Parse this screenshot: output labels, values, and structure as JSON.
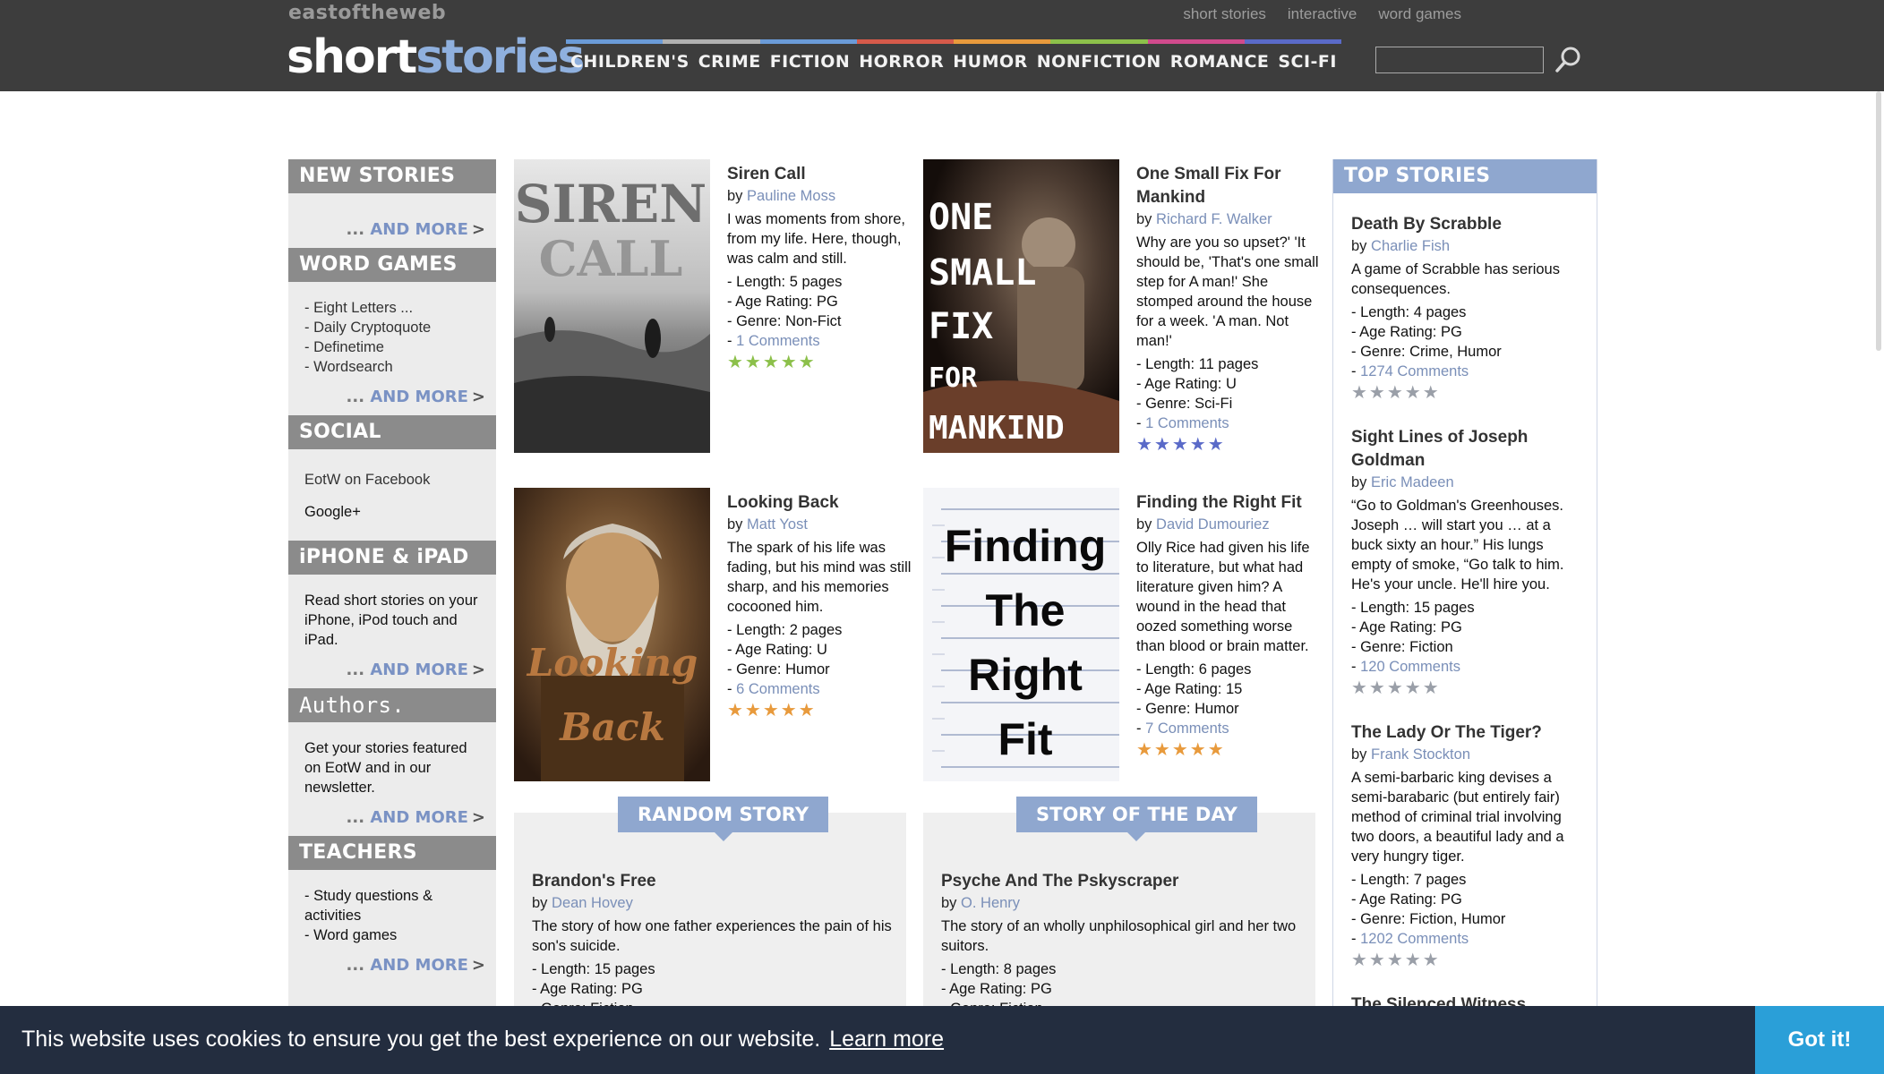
{
  "header": {
    "brand_small": "eastoftheweb",
    "logo_part1": "short",
    "logo_part2": "stories",
    "top_links": [
      "short stories",
      "interactive",
      "word games"
    ],
    "nav": [
      "CHILDREN'S",
      "CRIME",
      "FICTION",
      "HORROR",
      "HUMOR",
      "NONFICTION",
      "ROMANCE",
      "SCI-FI"
    ],
    "nav_colors": [
      "#6a9bd8",
      "#b0b0b0",
      "#6a9bd8",
      "#d65a4a",
      "#e89a3c",
      "#8cc04a",
      "#d04a8c",
      "#5a6ac8"
    ],
    "search_placeholder": ""
  },
  "sidebar": {
    "new_stories": {
      "title": "NEW STORIES"
    },
    "word_games": {
      "title": "WORD GAMES",
      "items": [
        "- Eight Letters ...",
        "- Daily Cryptoquote",
        "- Definetime",
        "- Wordsearch"
      ]
    },
    "social": {
      "title": "SOCIAL",
      "items": [
        "EotW on Facebook",
        "Google+"
      ]
    },
    "iphone": {
      "title": "iPHONE & iPAD",
      "text": "Read short stories on your iPhone, iPod touch and iPad."
    },
    "authors": {
      "title": "Authors.",
      "text": "Get your stories featured on EotW and in our newsletter."
    },
    "teachers": {
      "title": "TEACHERS",
      "items": [
        "- Study questions & activities",
        "- Word games"
      ]
    },
    "more_dots": "...",
    "more_label": "AND MORE",
    "more_chevron": ">"
  },
  "stories": [
    {
      "title": "Siren Call",
      "by": "by",
      "author": "Pauline Moss",
      "blurb": "I was moments from shore, from my life. Here, though, was calm and still.",
      "length": "- Length: 5 pages",
      "rating": "- Age Rating: PG",
      "genre": "- Genre: Non-Fict",
      "comments": "1 Comments",
      "stars": "★★★★★",
      "star_color": "#8cc04a",
      "cover_text": "SIREN CALL"
    },
    {
      "title": "One Small Fix For Mankind",
      "by": "by",
      "author": "Richard F. Walker",
      "blurb": "Why are you so upset?' 'It should be, 'That's one small step for A man!' She stomped around the house for a week. 'A man. Not man!'",
      "length": "- Length: 11 pages",
      "rating": "- Age Rating: U",
      "genre": "- Genre: Sci-Fi",
      "comments": "1 Comments",
      "stars": "★★★★★",
      "star_color": "#5a6ac8",
      "cover_text": [
        "ONE",
        "SMALL",
        "FIX",
        "FOR",
        "MANKIND"
      ]
    },
    {
      "title": "Looking Back",
      "by": "by",
      "author": "Matt Yost",
      "blurb": "The spark of his life was fading, but his mind was still sharp, and his memories cocooned him.",
      "length": "- Length: 2 pages",
      "rating": "- Age Rating: U",
      "genre": "- Genre: Humor",
      "comments": "6 Comments",
      "stars": "★★★★★",
      "star_color": "#e89a3c",
      "cover_text": [
        "Looking",
        "Back"
      ]
    },
    {
      "title": "Finding the Right Fit",
      "by": "by",
      "author": "David Dumouriez",
      "blurb": "Olly Rice had given his life to literature, but what had literature given him? A wound in the head that oozed something worse than blood or brain matter.",
      "length": "- Length: 6 pages",
      "rating": "- Age Rating: 15",
      "genre": "- Genre: Humor",
      "comments": "7 Comments",
      "stars": "★★★★★",
      "star_color": "#e89a3c",
      "cover_text": [
        "Finding",
        "The",
        "Right",
        "Fit"
      ]
    }
  ],
  "random_story": {
    "tab": "RANDOM STORY",
    "title": "Brandon's Free",
    "by": "by",
    "author": "Dean Hovey",
    "blurb": "The story of how one father experiences the pain of his son's suicide.",
    "length": "- Length: 15 pages",
    "rating": "- Age Rating: PG",
    "genre": "- Genre: Fiction"
  },
  "story_of_day": {
    "tab": "STORY OF THE DAY",
    "title": "Psyche And The Pskyscraper",
    "by": "by",
    "author": "O. Henry",
    "blurb": "The story of an wholly unphilosophical girl and her two suitors.",
    "length": "- Length: 8 pages",
    "rating": "- Age Rating: PG",
    "genre": "- Genre: Fiction"
  },
  "top_stories": {
    "title": "TOP STORIES",
    "items": [
      {
        "title": "Death By Scrabble",
        "by": "by",
        "author": "Charlie Fish",
        "blurb": "A game of Scrabble has serious consequences.",
        "length": "- Length: 4 pages",
        "rating": "- Age Rating: PG",
        "genre": "- Genre: Crime, Humor",
        "comments": "1274 Comments",
        "stars": "★★★★★"
      },
      {
        "title": "Sight Lines of Joseph Goldman",
        "by": "by",
        "author": "Eric Madeen",
        "blurb": "“Go to Goldman's Greenhouses. Joseph … will start you … at a buck sixty an hour.” His lungs empty of smoke, “Go talk to him. He's your uncle. He'll hire you.",
        "length": "- Length: 15 pages",
        "rating": "- Age Rating: PG",
        "genre": "- Genre: Fiction",
        "comments": "120 Comments",
        "stars": "★★★★★"
      },
      {
        "title": "The Lady Or The Tiger?",
        "by": "by",
        "author": "Frank Stockton",
        "blurb": "A semi-barbaric king devises a semi-barabaric (but entirely fair) method of criminal trial involving two doors, a beautiful lady and a very hungry tiger.",
        "length": "- Length: 7 pages",
        "rating": "- Age Rating: PG",
        "genre": "- Genre: Fiction, Humor",
        "comments": "1202 Comments",
        "stars": "★★★★★"
      },
      {
        "title": "The Silenced Witness"
      }
    ]
  },
  "cookie": {
    "text": "This website uses cookies to ensure you get the best experience on our website.",
    "link": "Learn more",
    "button": "Got it!"
  },
  "colors": {
    "header_bg": "#3d3d3d",
    "accent_blue": "#8fa7cf",
    "link_blue": "#7a8fb8",
    "cookie_bg": "#232d3f",
    "cookie_btn": "#2a9fd8"
  }
}
